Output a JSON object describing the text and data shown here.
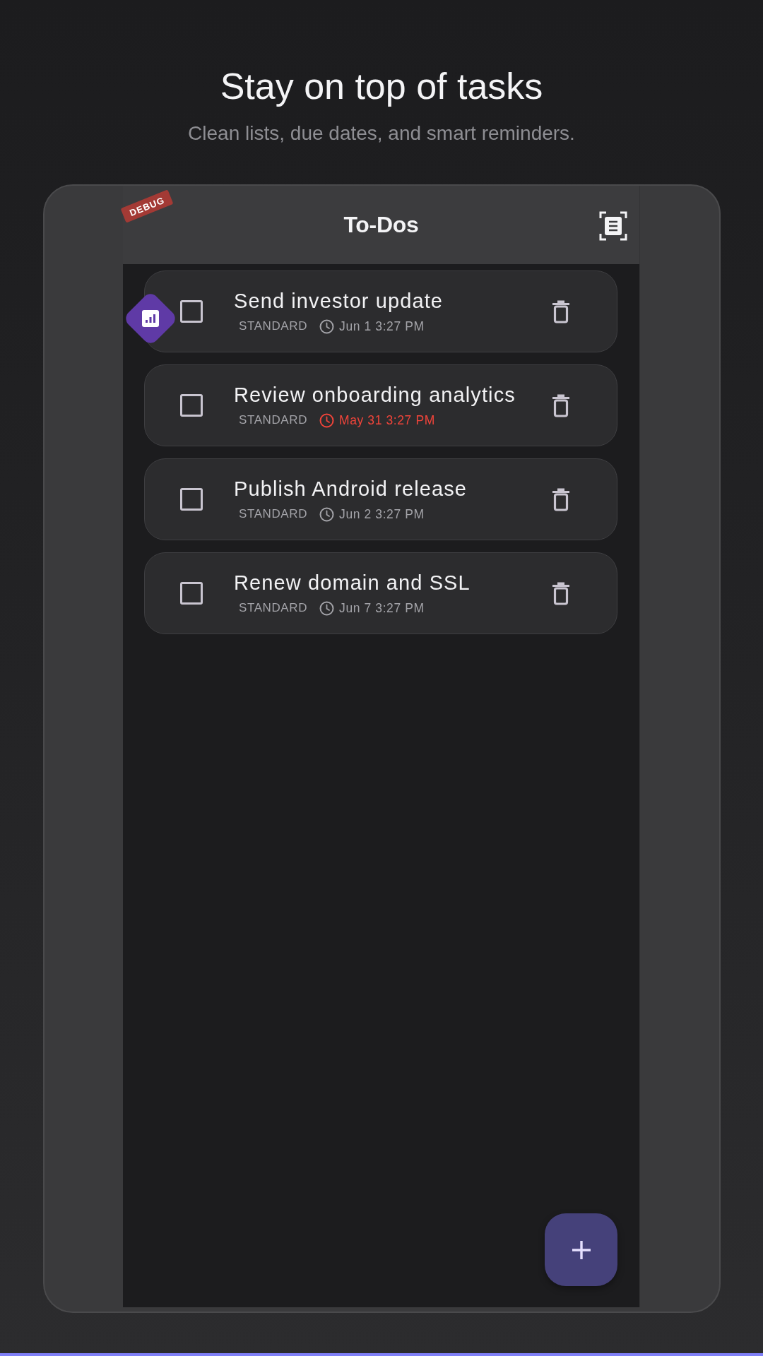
{
  "hero": {
    "title": "Stay on top of tasks",
    "subtitle": "Clean lists, due dates, and smart reminders."
  },
  "app_bar": {
    "title": "To-Dos",
    "debug_banner": "DEBUG"
  },
  "tasks": [
    {
      "title": "Send investor update",
      "category": "STANDARD",
      "due": "Jun 1 3:27 PM",
      "overdue": false,
      "checked": false
    },
    {
      "title": "Review onboarding analytics",
      "category": "STANDARD",
      "due": "May 31 3:27 PM",
      "overdue": true,
      "checked": false
    },
    {
      "title": "Publish Android release",
      "category": "STANDARD",
      "due": "Jun 2 3:27 PM",
      "overdue": false,
      "checked": false
    },
    {
      "title": "Renew domain and SSL",
      "category": "STANDARD",
      "due": "Jun 7 3:27 PM",
      "overdue": false,
      "checked": false
    }
  ]
}
